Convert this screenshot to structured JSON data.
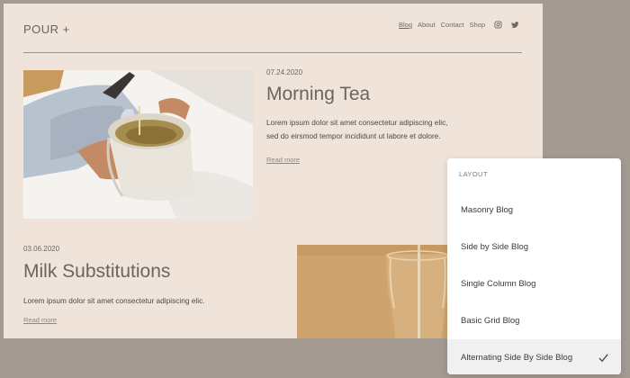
{
  "site": {
    "logo": "POUR +",
    "nav": [
      {
        "label": "Blog",
        "active": true
      },
      {
        "label": "About",
        "active": false
      },
      {
        "label": "Contact",
        "active": false
      },
      {
        "label": "Shop",
        "active": false
      }
    ],
    "social_icons": [
      "instagram-icon",
      "twitter-icon"
    ]
  },
  "posts": [
    {
      "date": "07.24.2020",
      "title": "Morning Tea",
      "excerpt_line1": "Lorem ipsum dolor sit amet consectetur adipiscing elic,",
      "excerpt_line2": "sed do eirsmod tempor incididunt ut labore et dolore.",
      "read_more": "Read more"
    },
    {
      "date": "03.06.2020",
      "title": "Milk Substitutions",
      "excerpt_line1": "Lorem ipsum dolor sit amet consectetur adipiscing elic.",
      "read_more": "Read more"
    }
  ],
  "layout_panel": {
    "header": "LAYOUT",
    "options": [
      "Masonry Blog",
      "Side by Side Blog",
      "Single Column Blog",
      "Basic Grid Blog",
      "Alternating Side By Side Blog"
    ],
    "selected_index": 4
  },
  "colors": {
    "page_bg": "#a39a92",
    "site_bg": "#f0e4da",
    "text_heading": "#6d645d",
    "panel_bg": "#ffffff",
    "selected_bg": "#f0f0f0"
  }
}
